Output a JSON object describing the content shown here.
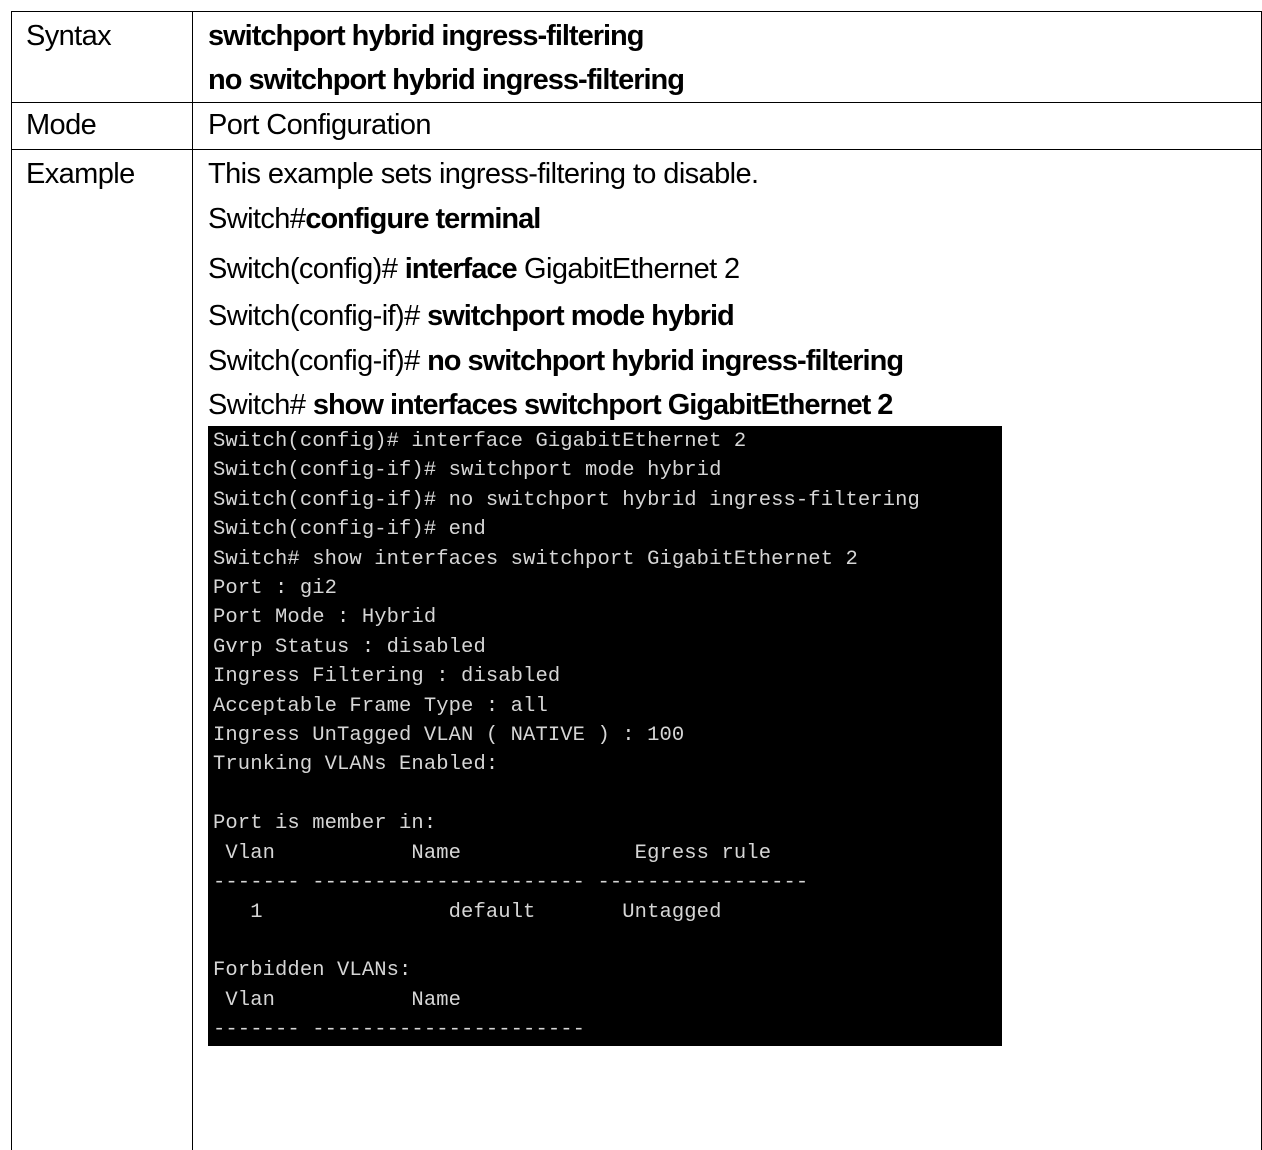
{
  "rows": {
    "syntax": {
      "label": "Syntax",
      "lines": [
        "switchport hybrid ingress-filtering",
        "no switchport hybrid ingress-filtering"
      ]
    },
    "mode": {
      "label": "Mode",
      "value": "Port Configuration"
    },
    "example": {
      "label": "Example",
      "description": "This example sets ingress-filtering to disable.",
      "commands": [
        {
          "prompt": "Switch#",
          "cmd": "configure terminal",
          "arg": ""
        },
        {
          "prompt": "Switch(config)# ",
          "cmd": "interface",
          "arg": " GigabitEthernet 2"
        },
        {
          "prompt": "Switch(config-if)# ",
          "cmd": "switchport mode hybrid",
          "arg": ""
        },
        {
          "prompt": "Switch(config-if)# ",
          "cmd": "no switchport hybrid ingress-filtering",
          "arg": ""
        },
        {
          "prompt": "Switch# ",
          "cmd": "show interfaces switchport GigabitEthernet 2",
          "arg": ""
        }
      ],
      "terminal_lines": [
        "Switch(config)# interface GigabitEthernet 2",
        "Switch(config-if)# switchport mode hybrid",
        "Switch(config-if)# no switchport hybrid ingress-filtering",
        "Switch(config-if)# end",
        "Switch# show interfaces switchport GigabitEthernet 2",
        "Port : gi2",
        "Port Mode : Hybrid",
        "Gvrp Status : disabled",
        "Ingress Filtering : disabled",
        "Acceptable Frame Type : all",
        "Ingress UnTagged VLAN ( NATIVE ) : 100",
        "Trunking VLANs Enabled:",
        "",
        "Port is member in:",
        " Vlan           Name              Egress rule",
        "------- ---------------------- -----------------",
        "   1               default       Untagged",
        "",
        "Forbidden VLANs:",
        " Vlan           Name",
        "------- ----------------------"
      ]
    }
  }
}
